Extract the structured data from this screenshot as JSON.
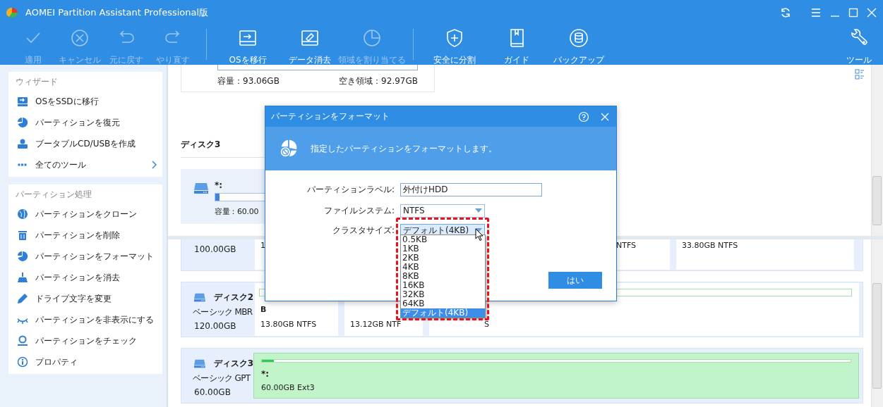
{
  "window": {
    "title": "AOMEI Partition Assistant Professional版"
  },
  "toolbar": [
    {
      "label": "適用",
      "disabled": true
    },
    {
      "label": "キャンセル",
      "disabled": true
    },
    {
      "label": "元に戻す",
      "disabled": true
    },
    {
      "label": "やり直す",
      "disabled": true
    },
    {
      "label": "OSを移行",
      "disabled": false
    },
    {
      "label": "データ消去",
      "disabled": false
    },
    {
      "label": "領域を割り当てる",
      "disabled": true
    },
    {
      "label": "安全に分割",
      "disabled": false
    },
    {
      "label": "ガイド",
      "disabled": false
    },
    {
      "label": "バックアップ",
      "disabled": false
    }
  ],
  "toolbar_right": {
    "label": "ツール"
  },
  "sidebar": {
    "sections": [
      {
        "title": "ウィザード",
        "items": [
          {
            "label": "OSをSSDに移行",
            "expandable": false
          },
          {
            "label": "パーティションを復元",
            "expandable": false
          },
          {
            "label": "ブータブルCD/USBを作成",
            "expandable": false
          },
          {
            "label": "全てのツール",
            "expandable": true
          }
        ]
      },
      {
        "title": "パーティション処理",
        "items": [
          {
            "label": "パーティションをクローン",
            "expandable": false
          },
          {
            "label": "パーティションを削除",
            "expandable": false
          },
          {
            "label": "パーティションをフォーマット",
            "expandable": false
          },
          {
            "label": "パーティションを消去",
            "expandable": false
          },
          {
            "label": "ドライブ文字を変更",
            "expandable": false
          },
          {
            "label": "パーティションを非表示にする",
            "expandable": false
          },
          {
            "label": "パーティションをチェック",
            "expandable": false
          },
          {
            "label": "プロパティ",
            "expandable": false
          }
        ]
      }
    ]
  },
  "top_pane": {
    "card": {
      "capacity": "容量：93.06GB",
      "free": "空き領域：92.97GB"
    },
    "disk_title": "ディスク3",
    "partition": {
      "name": "*:",
      "level": 0.02,
      "capacity": "容量：60.00"
    }
  },
  "bottom_pane": {
    "disks": [
      {
        "size": "100.00GB",
        "cells": [
          "1",
          "NTFS",
          "33.80GB NTFS"
        ]
      },
      {
        "name": "ディスク2",
        "type": "ベーシック MBR",
        "size": "120.00GB",
        "cells": [
          {
            "name": "B",
            "detail": "13.80GB NTFS"
          },
          {
            "detail": "13.12GB NTF"
          },
          {
            "detail": "S"
          }
        ]
      },
      {
        "name": "ディスク3",
        "type": "ベーシック GPT",
        "size": "60.00GB",
        "partition": {
          "name": "*:",
          "detail": "60.00GB Ext3",
          "level": 0.02
        }
      }
    ]
  },
  "dialog": {
    "title": "パーティションをフォーマット",
    "message": "指定したパーティションをフォーマットします。",
    "fields": [
      {
        "label": "パーティションラベル:",
        "kind": "text",
        "value": "外付けHDD",
        "focused": false
      },
      {
        "label": "ファイルシステム:",
        "kind": "select",
        "value": "NTFS",
        "focused": false
      },
      {
        "label": "クラスタサイズ:",
        "kind": "select",
        "value": "デフォルト(4KB)",
        "focused": true
      }
    ],
    "options": [
      {
        "label": "0.5KB",
        "selected": false
      },
      {
        "label": "1KB",
        "selected": false
      },
      {
        "label": "2KB",
        "selected": false
      },
      {
        "label": "4KB",
        "selected": false
      },
      {
        "label": "8KB",
        "selected": false
      },
      {
        "label": "16KB",
        "selected": false
      },
      {
        "label": "32KB",
        "selected": false
      },
      {
        "label": "64KB",
        "selected": false
      },
      {
        "label": "デフォルト(4KB)",
        "selected": true
      }
    ],
    "ok_button": "はい"
  }
}
